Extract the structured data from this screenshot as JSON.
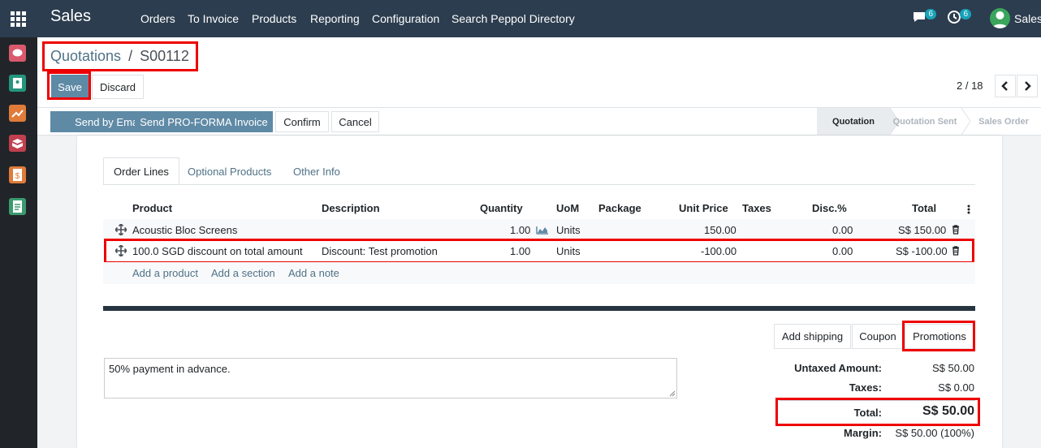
{
  "navbar": {
    "brand": "Sales",
    "menu": [
      "Orders",
      "To Invoice",
      "Products",
      "Reporting",
      "Configuration",
      "Search Peppol Directory"
    ],
    "messages_count": "6",
    "activities_count": "6",
    "user": "Sales"
  },
  "breadcrumb": {
    "parent": "Quotations",
    "separator": "/",
    "current": "S00112"
  },
  "actions": {
    "save": "Save",
    "discard": "Discard"
  },
  "pager": "2 / 18",
  "header_buttons": {
    "send_email": "Send by Email",
    "send_proforma": "Send PRO-FORMA Invoice",
    "confirm": "Confirm",
    "cancel": "Cancel"
  },
  "stages": {
    "quotation": "Quotation",
    "sent": "Quotation Sent",
    "order": "Sales Order"
  },
  "tabs": {
    "order_lines": "Order Lines",
    "optional": "Optional Products",
    "other": "Other Info"
  },
  "columns": {
    "product": "Product",
    "description": "Description",
    "quantity": "Quantity",
    "uom": "UoM",
    "package": "Package",
    "unit_price": "Unit Price",
    "taxes": "Taxes",
    "disc": "Disc.%",
    "total": "Total"
  },
  "lines": [
    {
      "product": "Acoustic Bloc Screens",
      "description": "",
      "quantity": "1.00",
      "uom": "Units",
      "unit_price": "150.00",
      "disc": "0.00",
      "total": "S$ 150.00"
    },
    {
      "product": "100.0 SGD discount on total amount",
      "description": "Discount: Test promotion",
      "quantity": "1.00",
      "uom": "Units",
      "unit_price": "-100.00",
      "disc": "0.00",
      "total": "S$ -100.00"
    }
  ],
  "add_links": {
    "product": "Add a product",
    "section": "Add a section",
    "note": "Add a note"
  },
  "footer_buttons": {
    "shipping": "Add shipping",
    "coupon": "Coupon",
    "promotions": "Promotions"
  },
  "note": "50% payment in advance.",
  "totals": {
    "untaxed_label": "Untaxed Amount:",
    "untaxed": "S$ 50.00",
    "taxes_label": "Taxes:",
    "taxes": "S$ 0.00",
    "total_label": "Total:",
    "total": "S$ 50.00",
    "margin_label": "Margin:",
    "margin": "S$ 50.00 (100%)"
  },
  "colors": {
    "navbar": "#2c3d4f",
    "primary": "#5f8aa6",
    "highlight": "#e00000"
  }
}
